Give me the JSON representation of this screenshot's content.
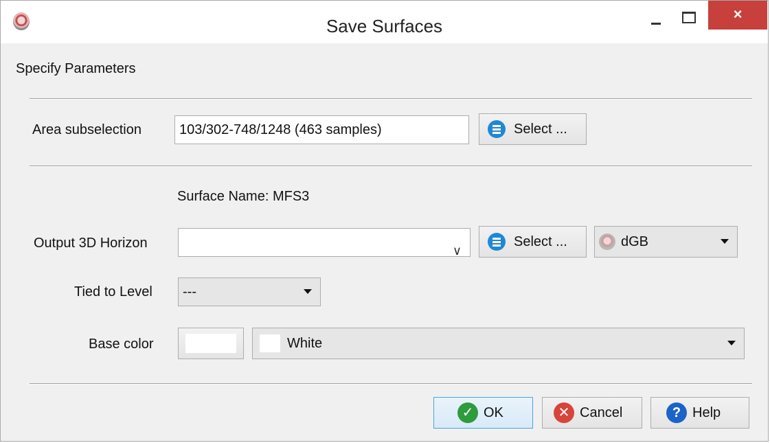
{
  "window": {
    "title": "Save Surfaces",
    "close_glyph": "×"
  },
  "section": {
    "label": "Specify Parameters"
  },
  "area": {
    "label": "Area subselection",
    "value": "103/302-748/1248 (463 samples)",
    "select_label": "Select ..."
  },
  "surface": {
    "name_label": "Surface Name: MFS3"
  },
  "output_horizon": {
    "label": "Output 3D Horizon",
    "value": "",
    "select_label": "Select ...",
    "format_value": "dGB"
  },
  "tied_level": {
    "label": "Tied to Level",
    "value": "---"
  },
  "base_color": {
    "label": "Base color",
    "swatch_color": "#ffffff",
    "value": "White"
  },
  "buttons": {
    "ok": "OK",
    "cancel": "Cancel",
    "help": "Help",
    "ok_glyph": "✓",
    "cancel_glyph": "✕",
    "help_glyph": "?"
  }
}
